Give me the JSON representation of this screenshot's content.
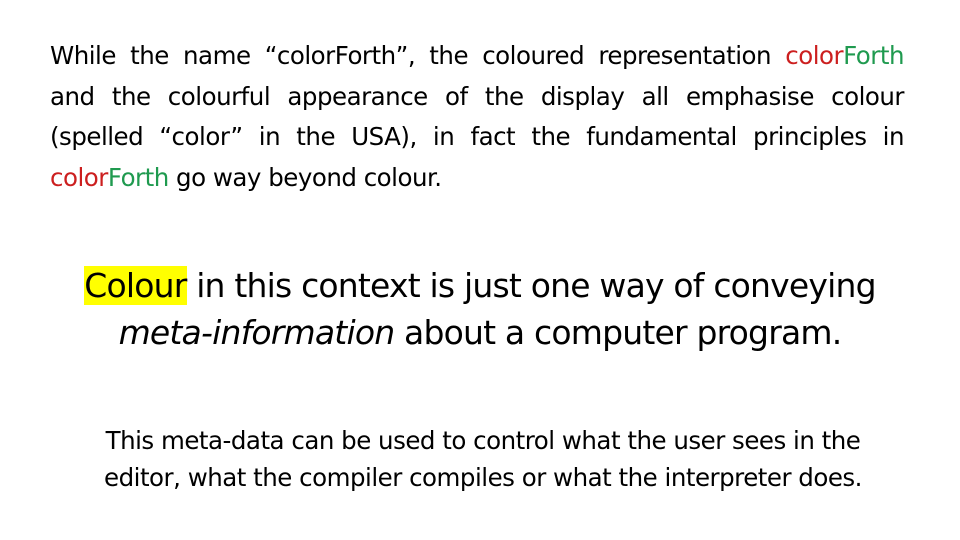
{
  "colors": {
    "color_word": "#cc1f1f",
    "forth_word": "#1f9a4f",
    "highlight": "#ffff00"
  },
  "paragraph1": {
    "s1": "While the name “colorForth”, the coloured representation ",
    "cf1_color": "color",
    "cf1_forth": "Forth",
    "s2": " and the colourful appearance of the display all emphasise colour (spelled “color” in the USA), in fact the fundamental principles in ",
    "cf2_color": "color",
    "cf2_forth": "Forth",
    "s3": " go way beyond colour."
  },
  "paragraph2": {
    "highlighted": "Colour",
    "s1": " in this context is just one way of conveying ",
    "italic": "meta-information",
    "s2": " about a computer program."
  },
  "paragraph3": {
    "line1": "This meta-data can be used to control what the user sees in the",
    "line2": "editor, what the compiler compiles or what the interpreter does."
  }
}
